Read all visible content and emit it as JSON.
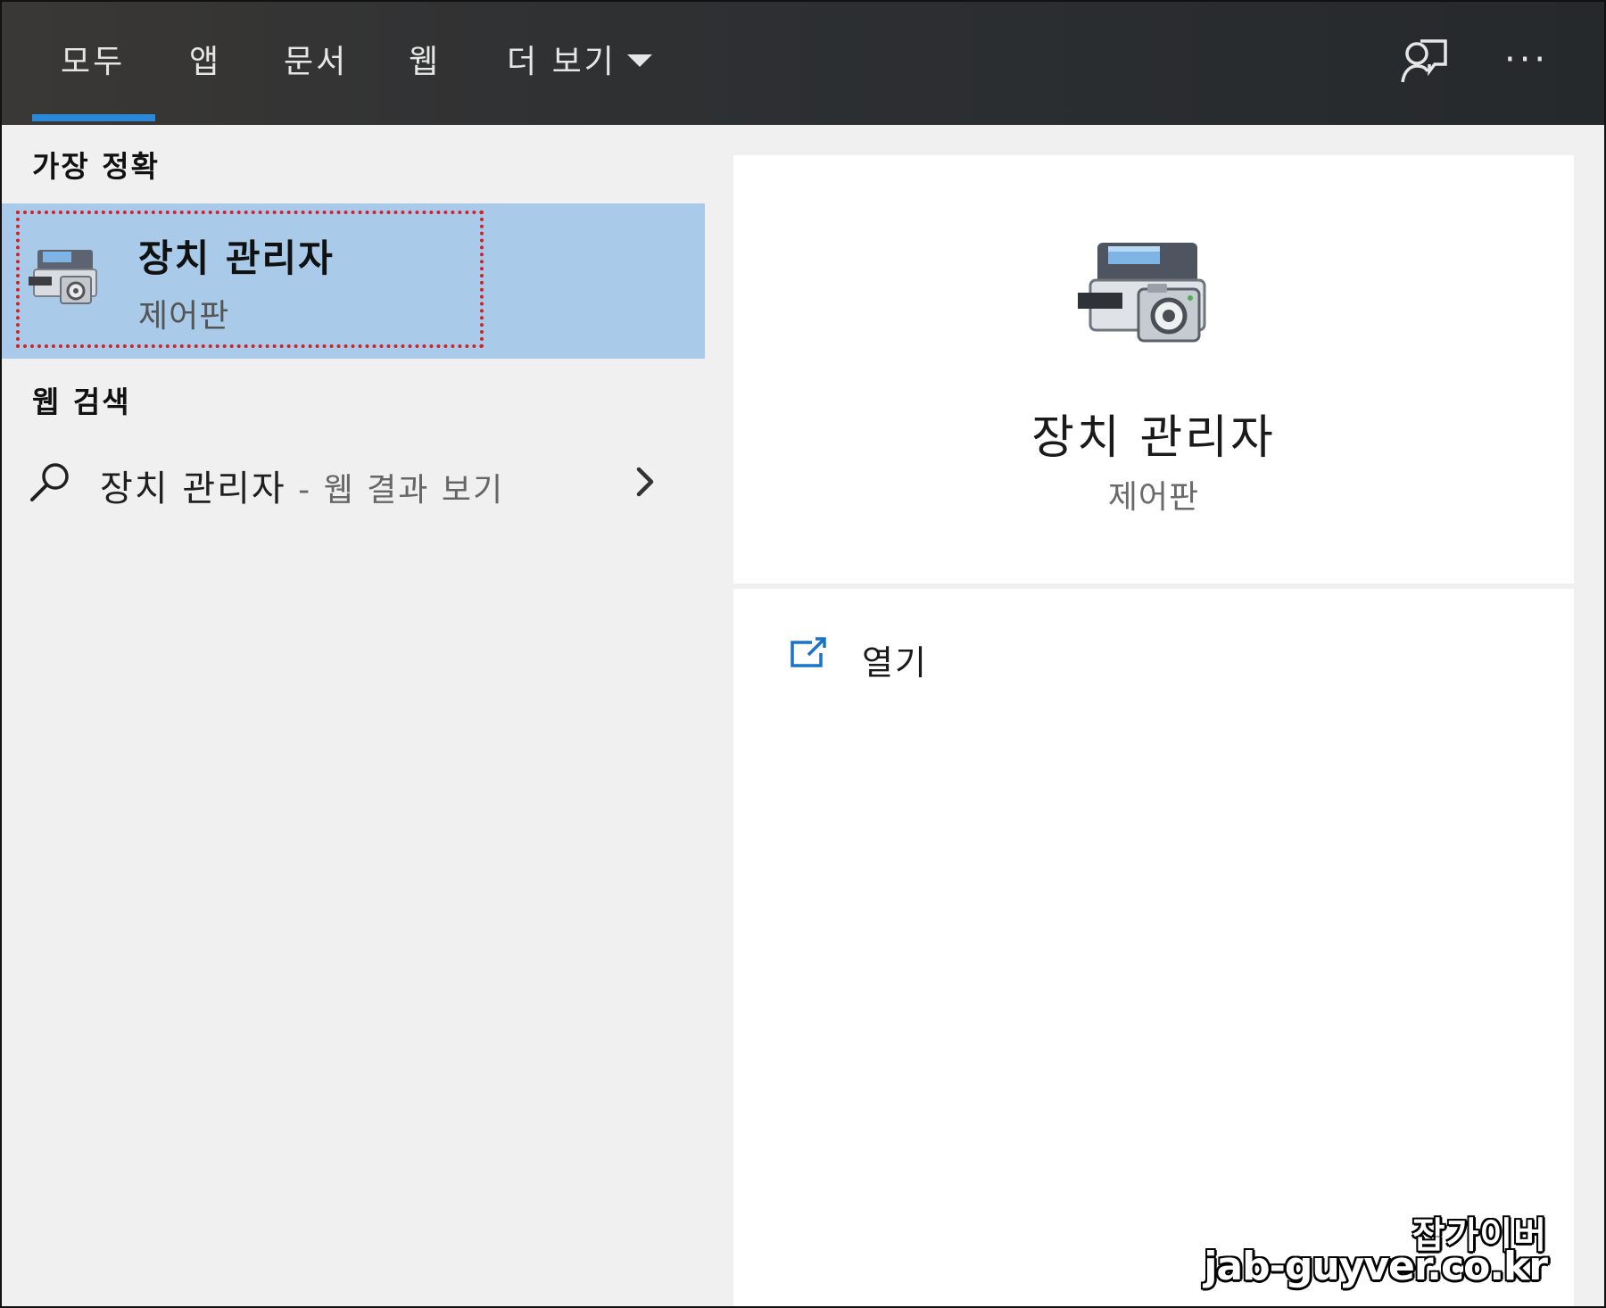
{
  "tabs": [
    {
      "label": "모두",
      "active": true
    },
    {
      "label": "앱"
    },
    {
      "label": "문서"
    },
    {
      "label": "웹"
    },
    {
      "label": "더 보기"
    }
  ],
  "header_icons": [
    "feedback-person-icon",
    "more-ellipsis-icon"
  ],
  "more_label": "···",
  "left": {
    "best_match_title": "가장 정확",
    "best_match": {
      "title": "장치 관리자",
      "subtitle": "제어판",
      "icon": "device-manager-icon"
    },
    "web_search_title": "웹 검색",
    "web_result": {
      "query": "장치 관리자",
      "suffix": " - 웹 결과 보기",
      "icon": "search-icon",
      "chevron": "chevron-right-icon"
    }
  },
  "detail": {
    "title": "장치 관리자",
    "subtitle": "제어판",
    "actions": [
      {
        "label": "열기",
        "icon": "open-external-icon"
      }
    ]
  },
  "watermark": {
    "line1": "잡가이버",
    "line2": "jab-guyver.co.kr"
  },
  "colors": {
    "accent": "#2b87d8",
    "selected_bg": "#a9cbe9",
    "highlight_border": "#d3222a",
    "topbar": "#2e3032"
  }
}
